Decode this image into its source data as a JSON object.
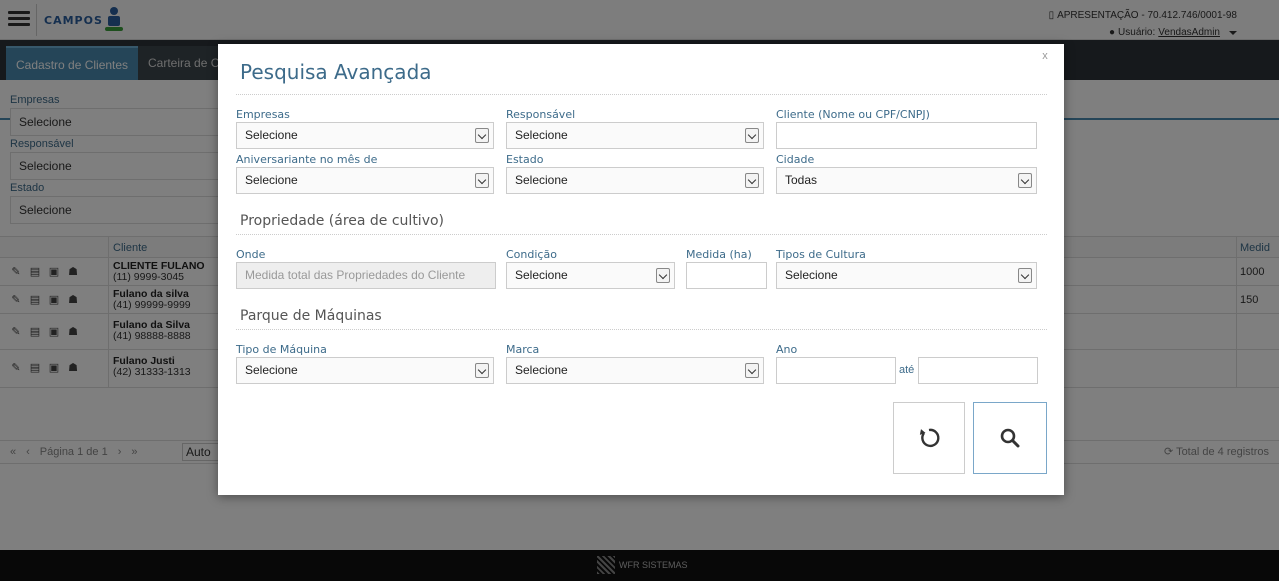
{
  "header": {
    "logo_text": "CAMPOS",
    "company": "APRESENTAÇÃO - 70.412.746/0001-98",
    "user_prefix": "Usuário:",
    "user_name": "VendasAdmin"
  },
  "tabs": [
    {
      "label": "Cadastro de Clientes"
    },
    {
      "label": "Carteira de Cl"
    }
  ],
  "filters": {
    "empresas_label": "Empresas",
    "empresas_value": "Selecione",
    "responsavel_label": "Responsável",
    "responsavel_value": "Selecione",
    "estado_label": "Estado",
    "estado_value": "Selecione"
  },
  "grid": {
    "col_client": "Cliente",
    "col_medida": "Medid",
    "rows": [
      {
        "name": "CLIENTE FULANO",
        "phone": "(11) 9999-3045",
        "medida": "1000"
      },
      {
        "name": "Fulano da silva",
        "phone": "(41) 99999-9999",
        "medida": "150"
      },
      {
        "name": "Fulano da Silva",
        "phone": "(41) 98888-8888",
        "medida": ""
      },
      {
        "name": "Fulano Justi",
        "phone": "(42) 31333-1313",
        "medida": ""
      }
    ]
  },
  "pager": {
    "first": "«",
    "prev": "‹",
    "page_text": "Página 1 de 1",
    "next": "›",
    "last": "»",
    "page_size": "Auto",
    "total": "Total de 4 registros"
  },
  "footer": {
    "brand": "WFR SISTEMAS"
  },
  "modal": {
    "close": "x",
    "title": "Pesquisa Avançada",
    "empresas_label": "Empresas",
    "empresas_value": "Selecione",
    "responsavel_label": "Responsável",
    "responsavel_value": "Selecione",
    "cliente_label": "Cliente (Nome ou CPF/CNPJ)",
    "cliente_value": "",
    "aniversariante_label": "Aniversariante no mês de",
    "aniversariante_value": "Selecione",
    "estado_label": "Estado",
    "estado_value": "Selecione",
    "cidade_label": "Cidade",
    "cidade_value": "Todas",
    "propriedade_title": "Propriedade (área de cultivo)",
    "onde_label": "Onde",
    "onde_placeholder": "Medida total das Propriedades do Cliente",
    "condicao_label": "Condição",
    "condicao_value": "Selecione",
    "medida_label": "Medida (ha)",
    "tipos_cultura_label": "Tipos de Cultura",
    "tipos_cultura_value": "Selecione",
    "parque_title": "Parque de Máquinas",
    "tipo_maquina_label": "Tipo de Máquina",
    "tipo_maquina_value": "Selecione",
    "marca_label": "Marca",
    "marca_value": "Selecione",
    "ano_label": "Ano",
    "ate_label": "até"
  }
}
